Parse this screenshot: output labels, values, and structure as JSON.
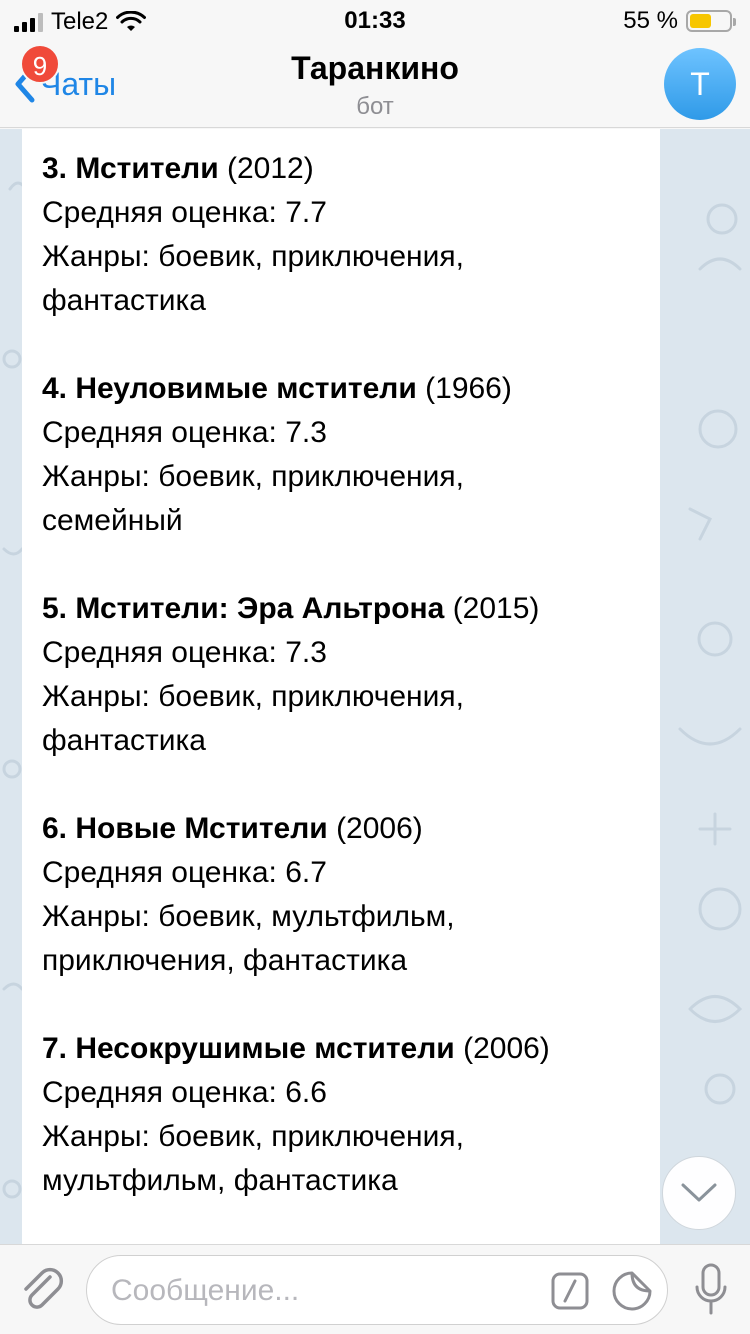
{
  "status_bar": {
    "carrier": "Tele2",
    "time": "01:33",
    "battery_percent": "55 %",
    "battery_level": 0.55
  },
  "nav": {
    "back_label": "Чаты",
    "unread_badge": "9",
    "title": "Таранкино",
    "subtitle": "бот",
    "avatar_letter": "T"
  },
  "message": {
    "entries": [
      {
        "title": "3. Мстители",
        "year": "(2012)",
        "rating": "Средняя оценка: 7.7",
        "genres_line1": "Жанры: боевик, приключения,",
        "genres_line2": "фантастика"
      },
      {
        "title": "4. Неуловимые мстители",
        "year": "(1966)",
        "rating": "Средняя оценка: 7.3",
        "genres_line1": "Жанры: боевик, приключения,",
        "genres_line2": "семейный"
      },
      {
        "title": "5. Мстители: Эра Альтрона",
        "year": "(2015)",
        "rating": "Средняя оценка: 7.3",
        "genres_line1": "Жанры: боевик, приключения,",
        "genres_line2": "фантастика"
      },
      {
        "title": "6. Новые Мстители",
        "year": "(2006)",
        "rating": "Средняя оценка: 6.7",
        "genres_line1": "Жанры: боевик, мультфильм,",
        "genres_line2": "приключения, фантастика"
      },
      {
        "title": "7. Несокрушимые мстители",
        "year": "(2006)",
        "rating": "Средняя оценка: 6.6",
        "genres_line1": "Жанры: боевик, приключения,",
        "genres_line2": "мультфильм, фантастика"
      }
    ]
  },
  "input": {
    "placeholder": "Сообщение..."
  },
  "colors": {
    "accent": "#1f86e6",
    "badge": "#f04a3a",
    "chat_background": "#dce6ee"
  },
  "icons": {
    "back": "chevron-left-icon",
    "attach": "paperclip-icon",
    "command": "slash-command-icon",
    "sticker": "sticker-icon",
    "mic": "microphone-icon",
    "scroll_down": "chevron-down-icon"
  }
}
